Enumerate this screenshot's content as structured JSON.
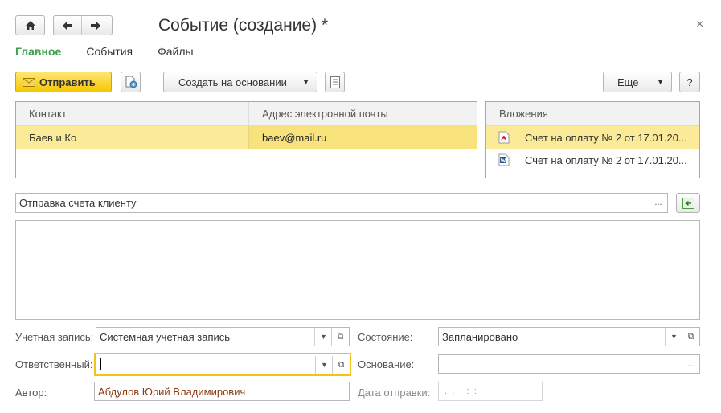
{
  "window": {
    "title": "Событие (создание) *",
    "close_glyph": "×"
  },
  "nav": {
    "home_icon": "home-icon",
    "back_icon": "arrow-left-icon",
    "forward_icon": "arrow-right-icon"
  },
  "tabs": [
    {
      "label": "Главное",
      "active": true
    },
    {
      "label": "События",
      "active": false
    },
    {
      "label": "Файлы",
      "active": false
    }
  ],
  "toolbar": {
    "send_label": "Отправить",
    "create_based_label": "Создать на основании",
    "more_label": "Еще",
    "help_label": "?"
  },
  "contacts_grid": {
    "columns": [
      "Контакт",
      "Адрес электронной почты"
    ],
    "rows": [
      {
        "contact": "Баев и Ко",
        "email": "baev@mail.ru",
        "selected": true
      }
    ]
  },
  "attachments": {
    "header": "Вложения",
    "items": [
      {
        "icon": "pdf-file-icon",
        "name": "Счет на оплату № 2 от 17.01.20...",
        "selected": true
      },
      {
        "icon": "word-file-icon",
        "name": "Счет на оплату № 2 от 17.01.20...",
        "selected": false
      }
    ]
  },
  "subject": {
    "value": "Отправка счета клиенту",
    "more_glyph": "..."
  },
  "body_text": "",
  "form": {
    "account_label": "Учетная запись:",
    "account_value": "Системная учетная запись",
    "responsible_label": "Ответственный:",
    "responsible_value": "",
    "author_label": "Автор:",
    "author_value": "Абдулов Юрий Владимирович",
    "state_label": "Состояние:",
    "state_value": "Запланировано",
    "basis_label": "Основание:",
    "basis_value": "",
    "send_date_label": "Дата отправки:",
    "send_date_value": " .  .     :  :"
  },
  "colors": {
    "accent_green": "#3fa14f",
    "send_button": "#f6c700",
    "selected_row": "#fbeb99",
    "author_text": "#8a3b12",
    "focus_border": "#f0c419"
  }
}
